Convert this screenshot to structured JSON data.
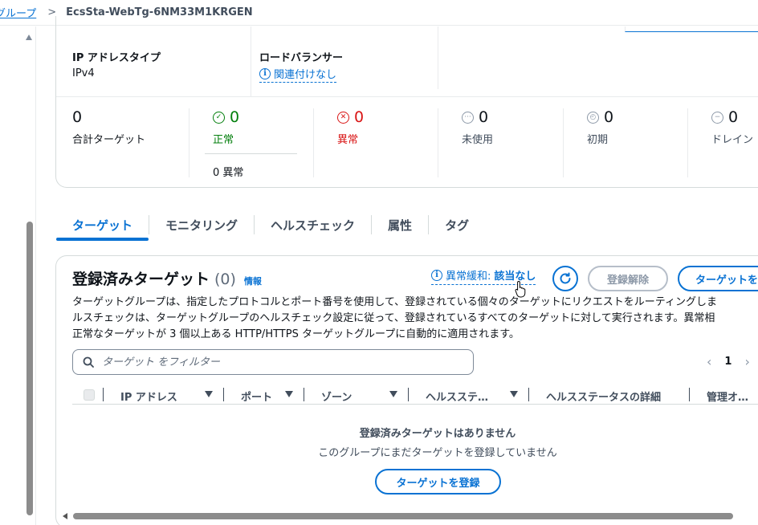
{
  "breadcrumb": {
    "parent": "グループ",
    "separator": ">",
    "current": "EcsSta-WebTg-6NM33M1KRGEN"
  },
  "details": {
    "ip_address_type_label": "IP アドレスタイプ",
    "ip_address_type_value": "IPv4",
    "load_balancer_label": "ロードバランサー",
    "load_balancer_info_icon": "i",
    "load_balancer_value": "関連付けなし"
  },
  "stats": {
    "total": {
      "value": "0",
      "label": "合計ターゲット"
    },
    "healthy": {
      "icon": "check-circle-icon",
      "value": "0",
      "label": "正常",
      "sub": "0 異常",
      "color": "#037f0c"
    },
    "unhealthy": {
      "icon": "x-circle-icon",
      "value": "0",
      "label": "異常",
      "color": "#d91515"
    },
    "unused": {
      "icon": "dots-circle-icon",
      "value": "0",
      "label": "未使用"
    },
    "initial": {
      "icon": "clock-circle-icon",
      "value": "0",
      "label": "初期"
    },
    "draining": {
      "icon": "minus-circle-icon",
      "value": "0",
      "label": "ドレイン"
    }
  },
  "tabs": [
    {
      "label": "ターゲット",
      "active": true
    },
    {
      "label": "モニタリング"
    },
    {
      "label": "ヘルスチェック"
    },
    {
      "label": "属性"
    },
    {
      "label": "タグ"
    }
  ],
  "targets": {
    "title": "登録済みターゲット",
    "count": "(0)",
    "info": "情報",
    "anomaly_label": "異常緩和:",
    "anomaly_value": "該当なし",
    "deregister_button": "登録解除",
    "register_button_truncated": "ターゲットを",
    "description": [
      "ターゲットグループは、指定したプロトコルとポート番号を使用して、登録されている個々のターゲットにリクエストをルーティングしま",
      "ルスチェックは、ターゲットグループのヘルスチェック設定に従って、登録されているすべてのターゲットに対して実行されます。異常相",
      "正常なターゲットが 3 個以上ある HTTP/HTTPS ターゲットグループに自動的に適用されます。"
    ],
    "filter_placeholder": "ターゲット をフィルター",
    "page": "1",
    "columns": [
      "IP アドレス",
      "ポート",
      "ゾーン",
      "ヘルスステ…",
      "ヘルスステータスの詳細",
      "管理オ…"
    ],
    "empty_title": "登録済みターゲットはありません",
    "empty_sub": "このグループにまだターゲットを登録していません",
    "empty_button": "ターゲットを登録"
  },
  "colors": {
    "accent": "#0972d3",
    "healthy": "#037f0c",
    "unhealthy": "#d91515",
    "muted": "#8d99a8"
  }
}
